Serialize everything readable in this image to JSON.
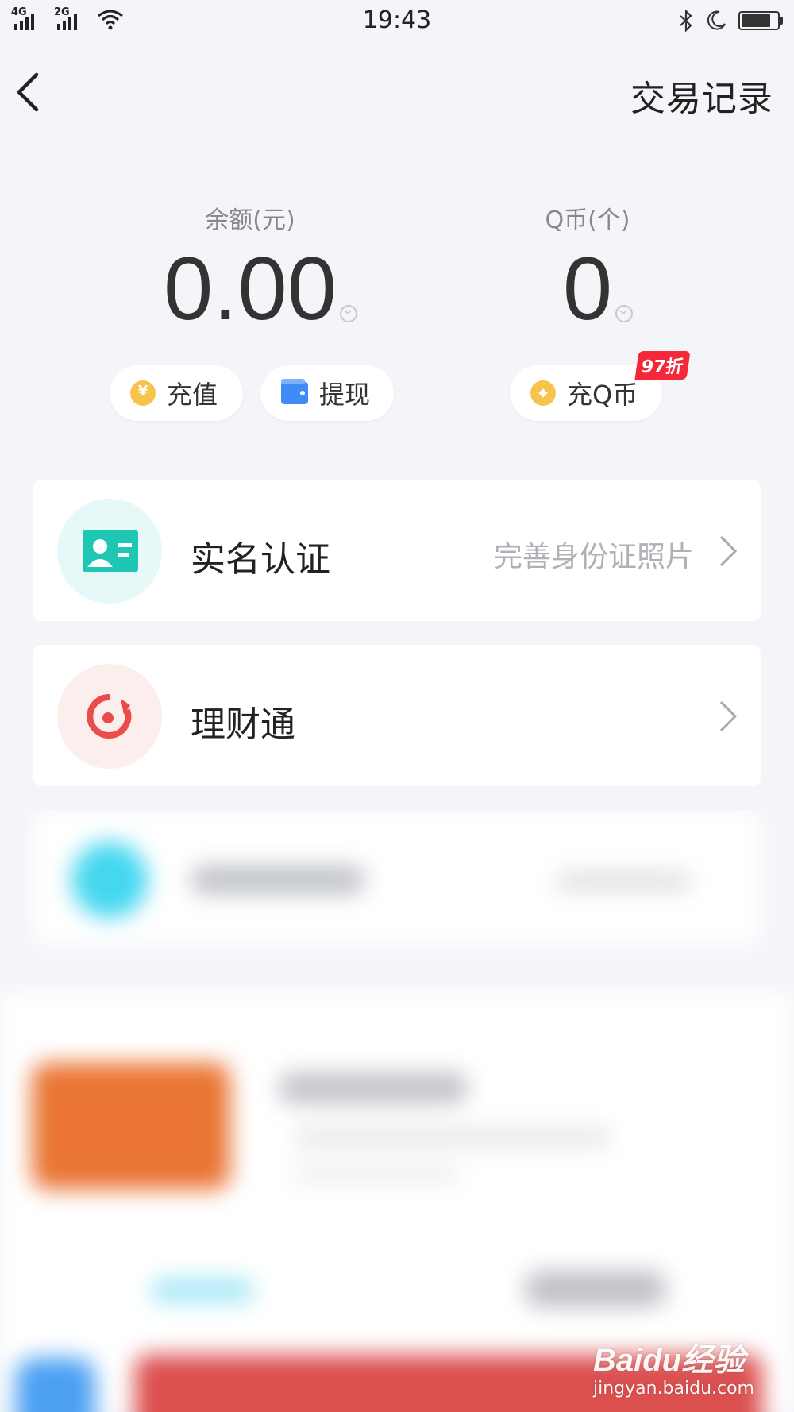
{
  "status_bar": {
    "time": "19:43",
    "network_1": "4G",
    "network_2": "2G",
    "icons": [
      "signal-icon",
      "wifi-icon",
      "bluetooth-icon",
      "moon-icon",
      "battery-icon"
    ]
  },
  "nav": {
    "back_icon": "chevron-left-icon",
    "right_label": "交易记录"
  },
  "balance": {
    "label": "余额(元)",
    "amount": "0.00"
  },
  "qcoin": {
    "label": "Q币(个)",
    "amount": "0"
  },
  "actions": {
    "recharge": "充值",
    "withdraw": "提现",
    "buy_qcoin": "充Q币",
    "discount_badge": "97折"
  },
  "list": [
    {
      "title": "实名认证",
      "subtitle": "完善身份证照片",
      "icon": "id-card-icon",
      "icon_bg": "#e6f8f8",
      "icon_color": "#1dc7b3"
    },
    {
      "title": "理财通",
      "subtitle": "",
      "icon": "licaitong-icon",
      "icon_bg": "#fdeeee",
      "icon_color": "#ea4b4b"
    }
  ],
  "watermark": {
    "main": "Baidu经验",
    "sub": "jingyan.baidu.com"
  },
  "colors": {
    "background": "#f4f5f9",
    "coin_yellow": "#f7c34a",
    "wallet_blue": "#3f8cf6",
    "badge_red": "#f5283a"
  }
}
